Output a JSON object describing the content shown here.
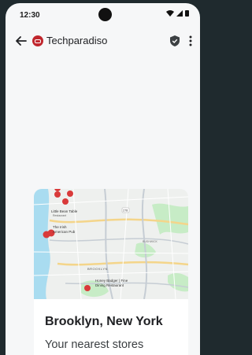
{
  "status_bar": {
    "time": "12:30"
  },
  "app_bar": {
    "site_name": "Techparadiso"
  },
  "card": {
    "title": "Brooklyn, New York",
    "subtitle": "Your nearest stores",
    "map": {
      "labels": {
        "place1": "Little Bean Table",
        "place1_sub": "Restaurant",
        "place2": "The Irish",
        "place2b": "American Pub",
        "place3": "Honey Badger | Fine",
        "place3b": "Dining Restaurant",
        "district": "BROOKLYN",
        "bushwick": "BUSHWICK",
        "road": "278"
      }
    }
  },
  "colors": {
    "pin": "#d93a3a",
    "water": "#a9dcf0",
    "park": "#c7ecc6",
    "road": "#ffffff",
    "highway": "#f4d58a"
  }
}
